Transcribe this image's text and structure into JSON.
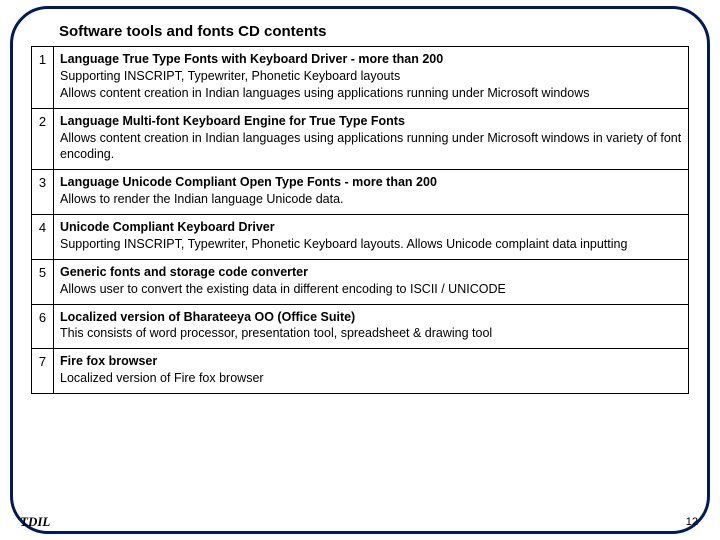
{
  "title": "Software tools and fonts CD contents",
  "rows": [
    {
      "num": "1",
      "heading": "Language True Type Fonts with Keyboard Driver - more than 200",
      "line1": " Supporting INSCRIPT, Typewriter, Phonetic Keyboard layouts",
      "line2": "Allows content creation in Indian languages using applications running under Microsoft windows"
    },
    {
      "num": "2",
      "heading": "Language Multi-font Keyboard Engine for True Type Fonts",
      "line1": "Allows content creation in Indian languages using applications running under Microsoft windows in variety of font encoding.",
      "line2": ""
    },
    {
      "num": "3",
      "heading": "Language Unicode Compliant Open Type Fonts - more than 200",
      "line1": "Allows to render the Indian language Unicode data.",
      "line2": ""
    },
    {
      "num": "4",
      "heading": "Unicode Compliant Keyboard Driver",
      "line1": "Supporting INSCRIPT, Typewriter, Phonetic Keyboard layouts. Allows Unicode complaint data inputting",
      "line2": ""
    },
    {
      "num": "5",
      "heading": "Generic fonts and storage code converter",
      "line1": "Allows user to convert the existing data in different encoding to ISCII / UNICODE",
      "line2": ""
    },
    {
      "num": "6",
      "heading": "Localized version of Bharateeya OO (Office Suite)",
      "line1": "This consists of word processor, presentation tool, spreadsheet & drawing tool",
      "line2": ""
    },
    {
      "num": "7",
      "heading": "Fire fox browser",
      "line1": "Localized version of Fire fox browser",
      "line2": ""
    }
  ],
  "footer_left": "TDIL",
  "footer_right": "12"
}
